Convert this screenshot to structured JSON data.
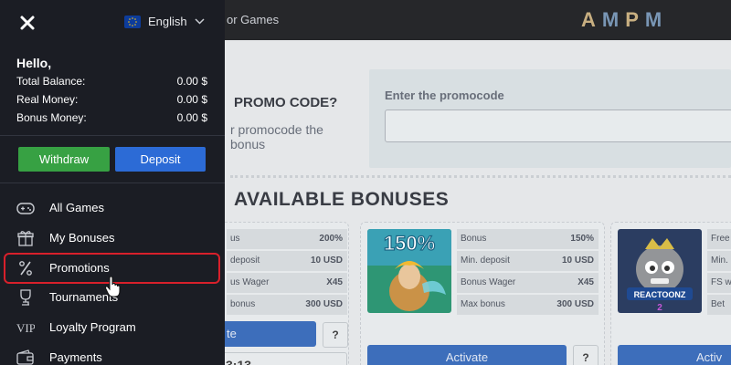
{
  "topbar": {
    "nav_link": "or Games",
    "logo": "AMPM"
  },
  "promo": {
    "title": "PROMO CODE?",
    "description": "r promocode the bonus",
    "input_label": "Enter the promocode",
    "input_value": ""
  },
  "bonuses": {
    "title": "AVAILABLE BONUSES",
    "card1": {
      "rows": [
        {
          "k": "us",
          "v": "200%"
        },
        {
          "k": "deposit",
          "v": "10 USD"
        },
        {
          "k": "us Wager",
          "v": "X45"
        },
        {
          "k": "bonus",
          "v": "300 USD"
        }
      ],
      "activate_label": "te",
      "question": "?",
      "timer": "3:13"
    },
    "card2": {
      "thumb_text": "150%",
      "rows": [
        {
          "k": "Bonus",
          "v": "150%"
        },
        {
          "k": "Min. deposit",
          "v": "10 USD"
        },
        {
          "k": "Bonus Wager",
          "v": "X45"
        },
        {
          "k": "Max bonus",
          "v": "300 USD"
        }
      ],
      "activate_label": "Activate",
      "question": "?"
    },
    "card3": {
      "thumb_text": "REACTOONZ",
      "thumb_num": "2",
      "rows": [
        {
          "k": "Free"
        },
        {
          "k": "Min."
        },
        {
          "k": "FS w"
        },
        {
          "k": "Bet"
        }
      ],
      "activate_label": "Activ"
    }
  },
  "drawer": {
    "language": "English",
    "greeting": "Hello,",
    "balances": [
      {
        "label": "Total Balance:",
        "value": "0.00 $"
      },
      {
        "label": "Real Money:",
        "value": "0.00 $"
      },
      {
        "label": "Bonus Money:",
        "value": "0.00 $"
      }
    ],
    "withdraw_label": "Withdraw",
    "deposit_label": "Deposit",
    "menu": [
      {
        "label": "All Games",
        "icon": "gamepad-icon"
      },
      {
        "label": "My Bonuses",
        "icon": "gift-icon"
      },
      {
        "label": "Promotions",
        "icon": "percent-icon"
      },
      {
        "label": "Tournaments",
        "icon": "trophy-icon"
      },
      {
        "label": "Loyalty Program",
        "icon": "vip-icon"
      },
      {
        "label": "Payments",
        "icon": "wallet-icon"
      }
    ]
  },
  "colors": {
    "drawer_bg": "#1b1d24",
    "withdraw": "#37a143",
    "deposit": "#2c6bd6",
    "highlight": "#d8202b",
    "activate": "#2f64b6"
  }
}
